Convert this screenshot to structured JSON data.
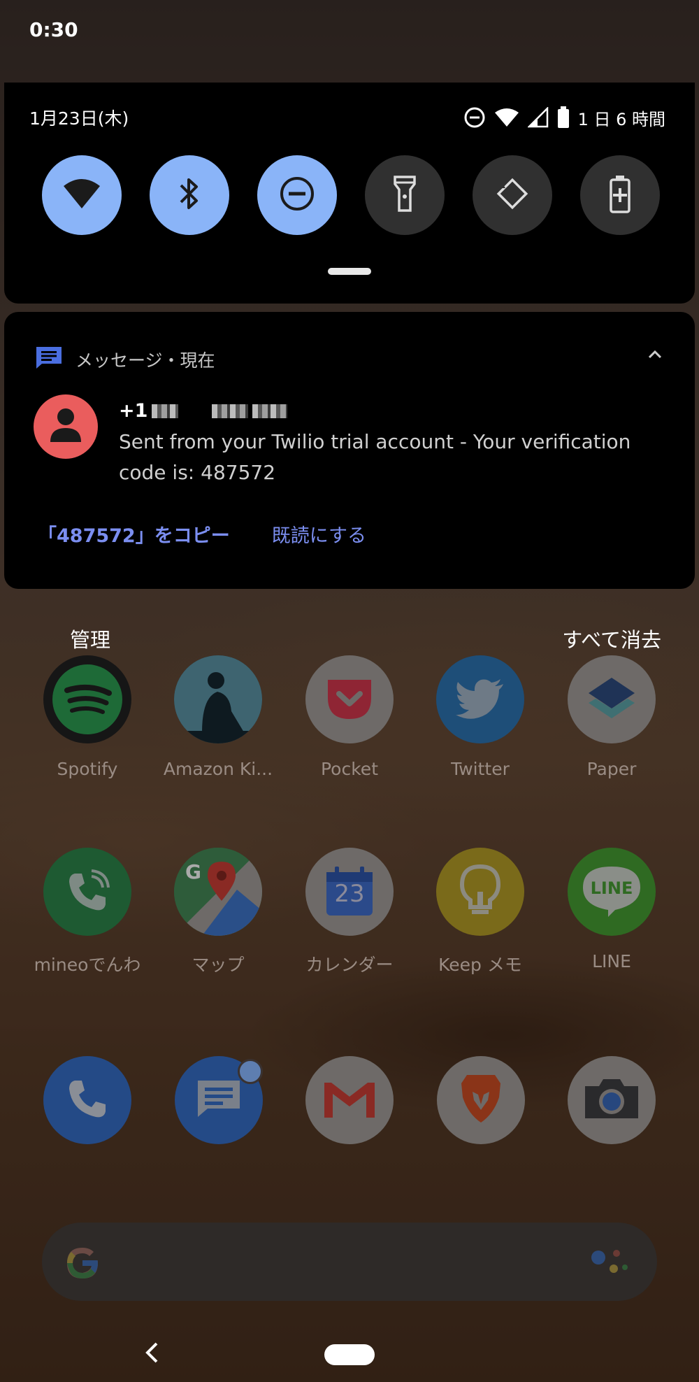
{
  "status_bar": {
    "time": "0:30"
  },
  "quick_settings": {
    "date": "1月23日(木)",
    "battery_text": "1 日 6 時間",
    "tiles": [
      {
        "name": "wifi",
        "state": "on"
      },
      {
        "name": "bluetooth",
        "state": "on"
      },
      {
        "name": "do-not-disturb",
        "state": "on"
      },
      {
        "name": "flashlight",
        "state": "off"
      },
      {
        "name": "auto-rotate",
        "state": "off"
      },
      {
        "name": "battery-saver",
        "state": "off"
      }
    ]
  },
  "notification": {
    "app": "メッセージ・現在",
    "sender": "+1",
    "body": "Sent from your Twilio trial account - Your verification code is: 487572",
    "actions": {
      "copy": "「487572」をコピー",
      "mark_read": "既読にする"
    }
  },
  "shade_footer": {
    "manage": "管理",
    "clear_all": "すべて消去"
  },
  "apps": {
    "row1": [
      "Spotify",
      "Amazon Ki...",
      "Pocket",
      "Twitter",
      "Paper"
    ],
    "row2": [
      "mineoでんわ",
      "マップ",
      "カレンダー",
      "Keep メモ",
      "LINE"
    ],
    "calendar_day": "23",
    "line_text": "LINE"
  },
  "colors": {
    "tile_on": "#8ab4f8",
    "tile_off": "#303030",
    "action_link": "#7b8ef0",
    "avatar": "#ea5d5d"
  }
}
